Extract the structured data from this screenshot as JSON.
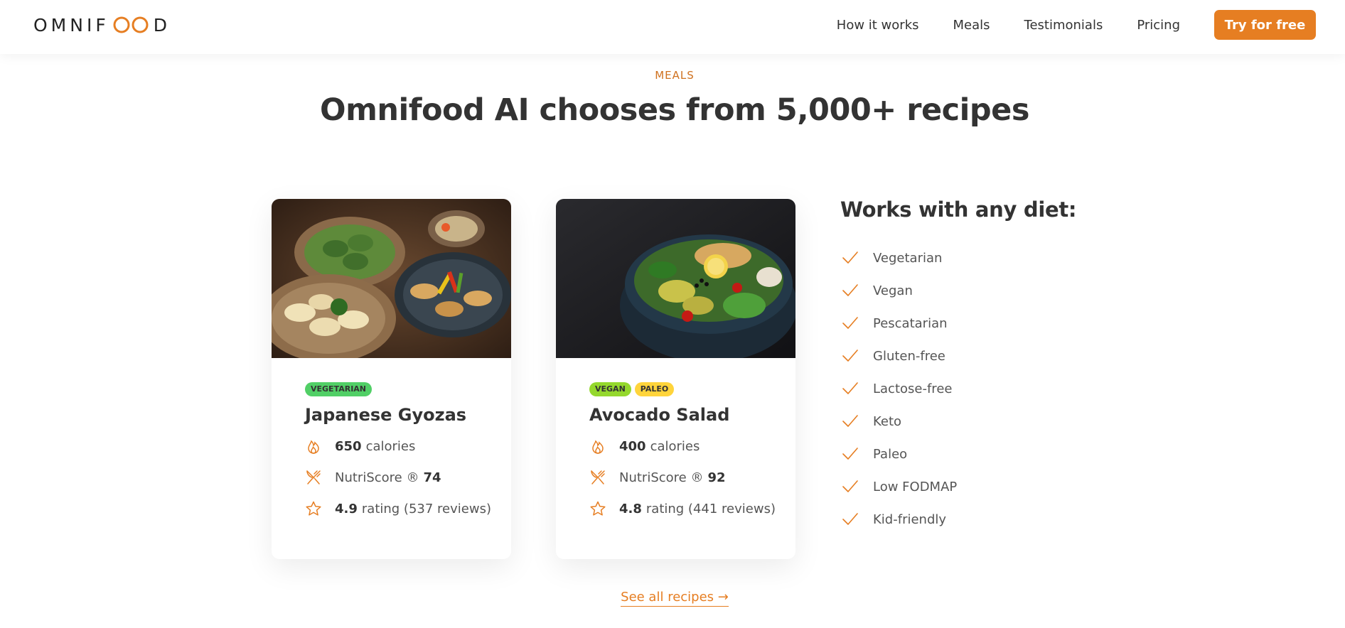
{
  "brand": {
    "logo_text_left": "OMNIF",
    "logo_text_right": "D",
    "accent": "#e67e22"
  },
  "nav": {
    "items": [
      "How it works",
      "Meals",
      "Testimonials",
      "Pricing"
    ],
    "cta": "Try for free"
  },
  "section": {
    "subheading": "MEALS",
    "heading": "Omnifood AI chooses from 5,000+ recipes"
  },
  "meals": [
    {
      "image": "japanese-gyozas-photo",
      "tags": [
        "VEGETARIAN"
      ],
      "title": "Japanese Gyozas",
      "calories_value": "650",
      "calories_label": "calories",
      "nutriscore_label": "NutriScore ®",
      "nutriscore_value": "74",
      "rating_value": "4.9",
      "rating_label": "rating (537 reviews)"
    },
    {
      "image": "avocado-salad-photo",
      "tags": [
        "VEGAN",
        "PALEO"
      ],
      "title": "Avocado Salad",
      "calories_value": "400",
      "calories_label": "calories",
      "nutriscore_label": "NutriScore ®",
      "nutriscore_value": "92",
      "rating_value": "4.8",
      "rating_label": "rating (441 reviews)"
    }
  ],
  "diets": {
    "title": "Works with any diet:",
    "items": [
      "Vegetarian",
      "Vegan",
      "Pescatarian",
      "Gluten-free",
      "Lactose-free",
      "Keto",
      "Paleo",
      "Low FODMAP",
      "Kid-friendly"
    ]
  },
  "all_recipes_link": "See all recipes →"
}
